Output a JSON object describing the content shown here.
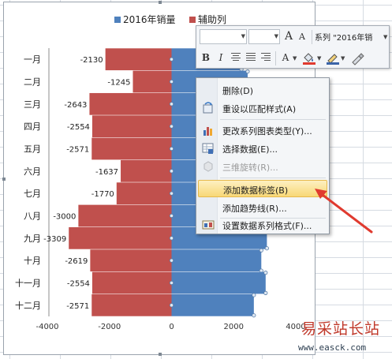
{
  "chart_data": {
    "type": "bar",
    "orientation": "horizontal",
    "stacked": true,
    "categories": [
      "一月",
      "二月",
      "三月",
      "四月",
      "五月",
      "六月",
      "七月",
      "八月",
      "九月",
      "十月",
      "十一月",
      "十二月"
    ],
    "series": [
      {
        "name": "2016年销量",
        "color": "#4f81bd",
        "values": [
          2250,
          2450,
          2300,
          2120,
          1920,
          2150,
          2000,
          2350,
          3070,
          2890,
          3030,
          2650
        ]
      },
      {
        "name": "辅助列",
        "color": "#c0504d",
        "values": [
          -2130,
          -1245,
          -2643,
          -2554,
          -2571,
          -1637,
          -1770,
          -3000,
          -3309,
          -2619,
          -2554,
          -2571
        ]
      }
    ],
    "data_labels": [
      "-2130",
      "-1245",
      "-2643",
      "-2554",
      "-2571",
      "-1637",
      "-1770",
      "-3000",
      "-3309",
      "-2619",
      "-2554",
      "-2571"
    ],
    "xlim": [
      -4000,
      4000
    ],
    "x_ticks": [
      "-4000",
      "-2000",
      "0",
      "2000",
      "4000"
    ],
    "legend": {
      "position": "top",
      "items": [
        "2016年销量",
        "辅助列"
      ]
    },
    "grid": false
  },
  "mini_toolbar": {
    "font_name": "",
    "font_size": "",
    "grow_font": "A",
    "shrink_font": "A",
    "series_selector": "系列 \"2016年销",
    "bold": "B",
    "italic": "I",
    "font_color": "A"
  },
  "context_menu": {
    "items": [
      {
        "label": "删除(D)",
        "icon": "none-icon",
        "enabled": true
      },
      {
        "label": "重设以匹配样式(A)",
        "icon": "reset-style-icon",
        "enabled": true
      },
      {
        "label": "更改系列图表类型(Y)...",
        "icon": "chart-type-icon",
        "enabled": true
      },
      {
        "label": "选择数据(E)...",
        "icon": "select-data-icon",
        "enabled": true
      },
      {
        "label": "三维旋转(R)...",
        "icon": "3d-rotation-icon",
        "enabled": false
      },
      {
        "label": "添加数据标签(B)",
        "icon": "none-icon",
        "enabled": true,
        "highlighted": true
      },
      {
        "label": "添加趋势线(R)...",
        "icon": "none-icon",
        "enabled": true
      },
      {
        "label": "设置数据系列格式(F)...",
        "icon": "format-series-icon",
        "enabled": true
      }
    ]
  },
  "watermark": {
    "title": "易采站长站",
    "url": "www.easck.com"
  },
  "colors": {
    "accent_arrow": "#e03a2f",
    "highlight": "#f8d877"
  }
}
